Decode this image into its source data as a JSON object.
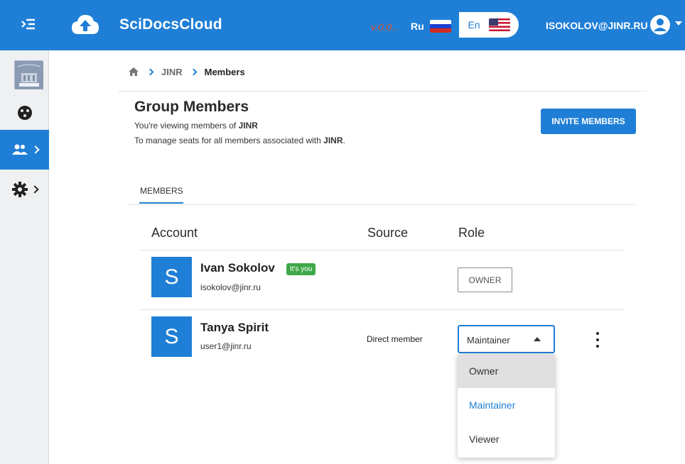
{
  "header": {
    "app_title": "SciDocsCloud",
    "version": "v.0.0..",
    "lang_ru": "Ru",
    "lang_en": "En",
    "user_email": "ISOKOLOV@JINR.RU",
    "brand_color": "#1f7fd6"
  },
  "sidebar": {
    "items": [
      {
        "icon": "palette-icon",
        "active": false
      },
      {
        "icon": "group-icon",
        "active": true
      },
      {
        "icon": "gear-icon",
        "active": false
      }
    ]
  },
  "breadcrumb": {
    "items": [
      "JINR",
      "Members"
    ]
  },
  "page": {
    "title": "Group Members",
    "subtitle_prefix": "You're viewing members of",
    "group_name": "JINR",
    "manage_prefix": "To manage seats for all members associated with",
    "manage_suffix": ".",
    "invite_label": "INVITE MEMBERS"
  },
  "tabs": {
    "members": "MEMBERS"
  },
  "table": {
    "columns": [
      "Account",
      "Source",
      "Role"
    ],
    "rows": [
      {
        "avatar": "S",
        "name": "Ivan Sokolov",
        "badge": "It's you",
        "email": "isokolov@jinr.ru",
        "source": "",
        "role": "OWNER"
      },
      {
        "avatar": "S",
        "name": "Tanya Spirit",
        "email": "user1@jinr.ru",
        "source": "Direct member",
        "role": "Maintainer"
      }
    ]
  },
  "role_dropdown": {
    "options": [
      "Owner",
      "Maintainer",
      "Viewer"
    ],
    "selected": "Maintainer",
    "hovered": "Owner"
  }
}
